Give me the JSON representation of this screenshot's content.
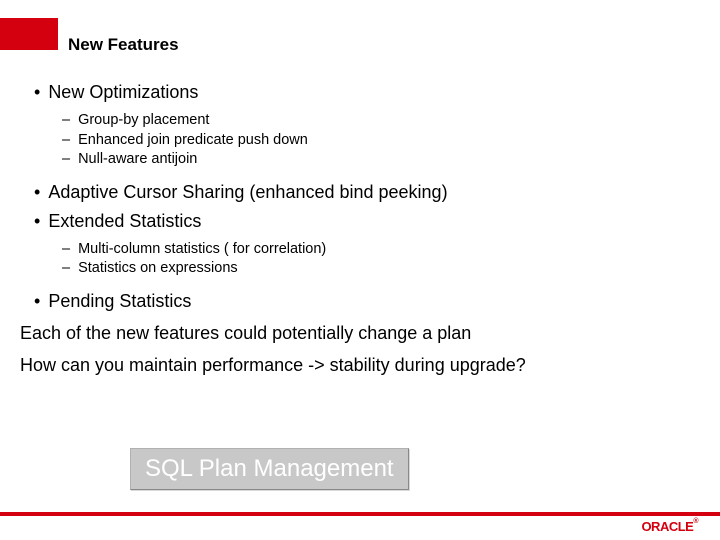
{
  "title": "New Features",
  "bullets": {
    "b1": "New Optimizations",
    "b1_sub": {
      "s1": "Group-by placement",
      "s2": "Enhanced join predicate push down",
      "s3": "Null-aware antijoin"
    },
    "b2": "Adaptive Cursor Sharing (enhanced bind peeking)",
    "b3": "Extended Statistics",
    "b3_sub": {
      "s1": "Multi-column statistics ( for correlation)",
      "s2": "Statistics on expressions"
    },
    "b4": "Pending Statistics"
  },
  "para1": "Each of the new features could potentially change a plan",
  "para2": "How can you maintain performance -> stability during upgrade?",
  "answer": "SQL Plan Management",
  "logo_text": "ORACLE",
  "logo_reg": "®"
}
